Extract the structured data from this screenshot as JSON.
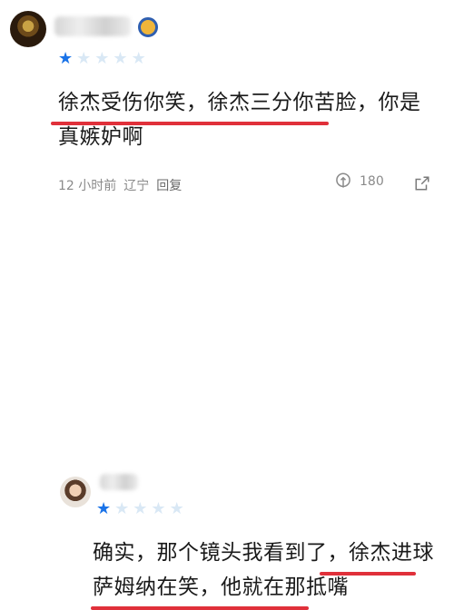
{
  "comments": [
    {
      "rating": {
        "filled": 1,
        "total": 5
      },
      "text": "徐杰受伤你笑，徐杰三分你苦脸，你是真嫉妒啊",
      "time": "12 小时前",
      "location": "辽宁",
      "reply_label": "回复",
      "like_count": "180"
    },
    {
      "rating": {
        "filled": 1,
        "total": 5
      },
      "text": "确实，那个镜头我看到了，徐杰进球萨姆纳在笑，他就在那抵嘴"
    }
  ],
  "colors": {
    "underline": "#e0303a",
    "star_filled": "#1a73e8",
    "star_empty": "#d9e8f5"
  },
  "icons": {
    "like": "thumb-icon",
    "share": "share-icon"
  }
}
